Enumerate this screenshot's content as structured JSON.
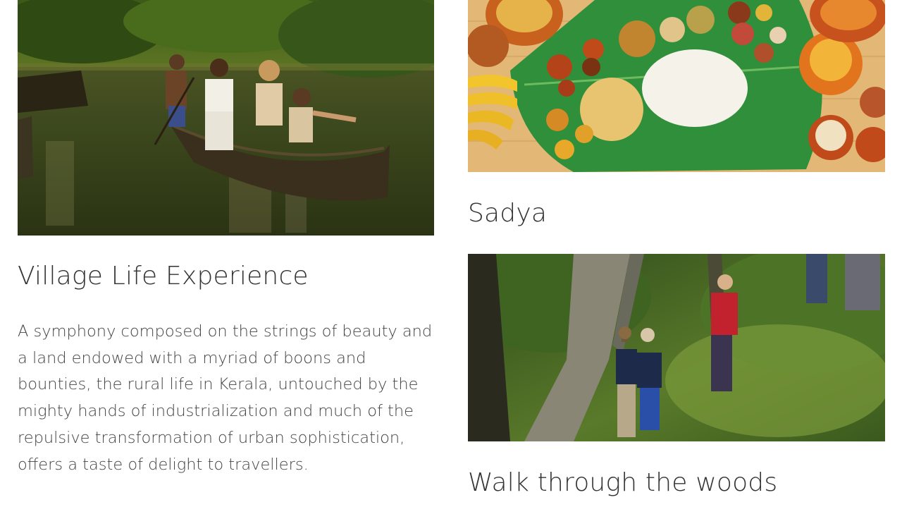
{
  "cards": {
    "village": {
      "title": "Village Life Experience",
      "description": "A symphony composed on the strings of beauty and a land endowed with a myriad of boons and bounties, the rural life in Kerala, untouched by the mighty hands of industrialization and much of the repulsive transformation of urban sophistication, offers a taste of delight to travellers."
    },
    "sadya": {
      "title": "Sadya"
    },
    "walk": {
      "title": "Walk through the woods"
    }
  }
}
